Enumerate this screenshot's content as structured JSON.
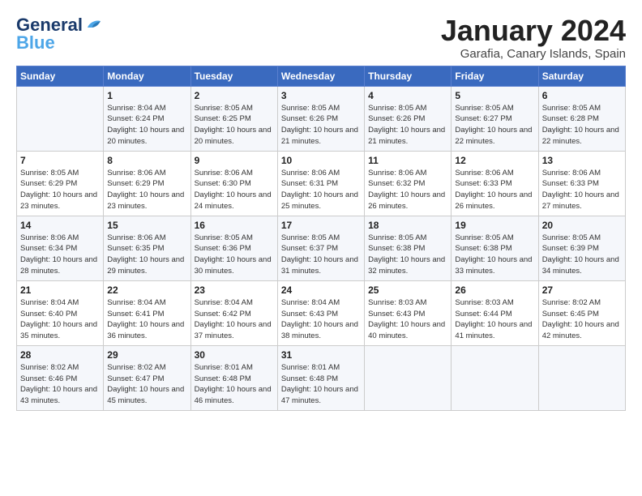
{
  "logo": {
    "line1": "General",
    "line2": "Blue"
  },
  "title": "January 2024",
  "location": "Garafia, Canary Islands, Spain",
  "headers": [
    "Sunday",
    "Monday",
    "Tuesday",
    "Wednesday",
    "Thursday",
    "Friday",
    "Saturday"
  ],
  "weeks": [
    [
      {
        "day": "",
        "sunrise": "",
        "sunset": "",
        "daylight": ""
      },
      {
        "day": "1",
        "sunrise": "Sunrise: 8:04 AM",
        "sunset": "Sunset: 6:24 PM",
        "daylight": "Daylight: 10 hours and 20 minutes."
      },
      {
        "day": "2",
        "sunrise": "Sunrise: 8:05 AM",
        "sunset": "Sunset: 6:25 PM",
        "daylight": "Daylight: 10 hours and 20 minutes."
      },
      {
        "day": "3",
        "sunrise": "Sunrise: 8:05 AM",
        "sunset": "Sunset: 6:26 PM",
        "daylight": "Daylight: 10 hours and 21 minutes."
      },
      {
        "day": "4",
        "sunrise": "Sunrise: 8:05 AM",
        "sunset": "Sunset: 6:26 PM",
        "daylight": "Daylight: 10 hours and 21 minutes."
      },
      {
        "day": "5",
        "sunrise": "Sunrise: 8:05 AM",
        "sunset": "Sunset: 6:27 PM",
        "daylight": "Daylight: 10 hours and 22 minutes."
      },
      {
        "day": "6",
        "sunrise": "Sunrise: 8:05 AM",
        "sunset": "Sunset: 6:28 PM",
        "daylight": "Daylight: 10 hours and 22 minutes."
      }
    ],
    [
      {
        "day": "7",
        "sunrise": "Sunrise: 8:05 AM",
        "sunset": "Sunset: 6:29 PM",
        "daylight": "Daylight: 10 hours and 23 minutes."
      },
      {
        "day": "8",
        "sunrise": "Sunrise: 8:06 AM",
        "sunset": "Sunset: 6:29 PM",
        "daylight": "Daylight: 10 hours and 23 minutes."
      },
      {
        "day": "9",
        "sunrise": "Sunrise: 8:06 AM",
        "sunset": "Sunset: 6:30 PM",
        "daylight": "Daylight: 10 hours and 24 minutes."
      },
      {
        "day": "10",
        "sunrise": "Sunrise: 8:06 AM",
        "sunset": "Sunset: 6:31 PM",
        "daylight": "Daylight: 10 hours and 25 minutes."
      },
      {
        "day": "11",
        "sunrise": "Sunrise: 8:06 AM",
        "sunset": "Sunset: 6:32 PM",
        "daylight": "Daylight: 10 hours and 26 minutes."
      },
      {
        "day": "12",
        "sunrise": "Sunrise: 8:06 AM",
        "sunset": "Sunset: 6:33 PM",
        "daylight": "Daylight: 10 hours and 26 minutes."
      },
      {
        "day": "13",
        "sunrise": "Sunrise: 8:06 AM",
        "sunset": "Sunset: 6:33 PM",
        "daylight": "Daylight: 10 hours and 27 minutes."
      }
    ],
    [
      {
        "day": "14",
        "sunrise": "Sunrise: 8:06 AM",
        "sunset": "Sunset: 6:34 PM",
        "daylight": "Daylight: 10 hours and 28 minutes."
      },
      {
        "day": "15",
        "sunrise": "Sunrise: 8:06 AM",
        "sunset": "Sunset: 6:35 PM",
        "daylight": "Daylight: 10 hours and 29 minutes."
      },
      {
        "day": "16",
        "sunrise": "Sunrise: 8:05 AM",
        "sunset": "Sunset: 6:36 PM",
        "daylight": "Daylight: 10 hours and 30 minutes."
      },
      {
        "day": "17",
        "sunrise": "Sunrise: 8:05 AM",
        "sunset": "Sunset: 6:37 PM",
        "daylight": "Daylight: 10 hours and 31 minutes."
      },
      {
        "day": "18",
        "sunrise": "Sunrise: 8:05 AM",
        "sunset": "Sunset: 6:38 PM",
        "daylight": "Daylight: 10 hours and 32 minutes."
      },
      {
        "day": "19",
        "sunrise": "Sunrise: 8:05 AM",
        "sunset": "Sunset: 6:38 PM",
        "daylight": "Daylight: 10 hours and 33 minutes."
      },
      {
        "day": "20",
        "sunrise": "Sunrise: 8:05 AM",
        "sunset": "Sunset: 6:39 PM",
        "daylight": "Daylight: 10 hours and 34 minutes."
      }
    ],
    [
      {
        "day": "21",
        "sunrise": "Sunrise: 8:04 AM",
        "sunset": "Sunset: 6:40 PM",
        "daylight": "Daylight: 10 hours and 35 minutes."
      },
      {
        "day": "22",
        "sunrise": "Sunrise: 8:04 AM",
        "sunset": "Sunset: 6:41 PM",
        "daylight": "Daylight: 10 hours and 36 minutes."
      },
      {
        "day": "23",
        "sunrise": "Sunrise: 8:04 AM",
        "sunset": "Sunset: 6:42 PM",
        "daylight": "Daylight: 10 hours and 37 minutes."
      },
      {
        "day": "24",
        "sunrise": "Sunrise: 8:04 AM",
        "sunset": "Sunset: 6:43 PM",
        "daylight": "Daylight: 10 hours and 38 minutes."
      },
      {
        "day": "25",
        "sunrise": "Sunrise: 8:03 AM",
        "sunset": "Sunset: 6:43 PM",
        "daylight": "Daylight: 10 hours and 40 minutes."
      },
      {
        "day": "26",
        "sunrise": "Sunrise: 8:03 AM",
        "sunset": "Sunset: 6:44 PM",
        "daylight": "Daylight: 10 hours and 41 minutes."
      },
      {
        "day": "27",
        "sunrise": "Sunrise: 8:02 AM",
        "sunset": "Sunset: 6:45 PM",
        "daylight": "Daylight: 10 hours and 42 minutes."
      }
    ],
    [
      {
        "day": "28",
        "sunrise": "Sunrise: 8:02 AM",
        "sunset": "Sunset: 6:46 PM",
        "daylight": "Daylight: 10 hours and 43 minutes."
      },
      {
        "day": "29",
        "sunrise": "Sunrise: 8:02 AM",
        "sunset": "Sunset: 6:47 PM",
        "daylight": "Daylight: 10 hours and 45 minutes."
      },
      {
        "day": "30",
        "sunrise": "Sunrise: 8:01 AM",
        "sunset": "Sunset: 6:48 PM",
        "daylight": "Daylight: 10 hours and 46 minutes."
      },
      {
        "day": "31",
        "sunrise": "Sunrise: 8:01 AM",
        "sunset": "Sunset: 6:48 PM",
        "daylight": "Daylight: 10 hours and 47 minutes."
      },
      {
        "day": "",
        "sunrise": "",
        "sunset": "",
        "daylight": ""
      },
      {
        "day": "",
        "sunrise": "",
        "sunset": "",
        "daylight": ""
      },
      {
        "day": "",
        "sunrise": "",
        "sunset": "",
        "daylight": ""
      }
    ]
  ]
}
